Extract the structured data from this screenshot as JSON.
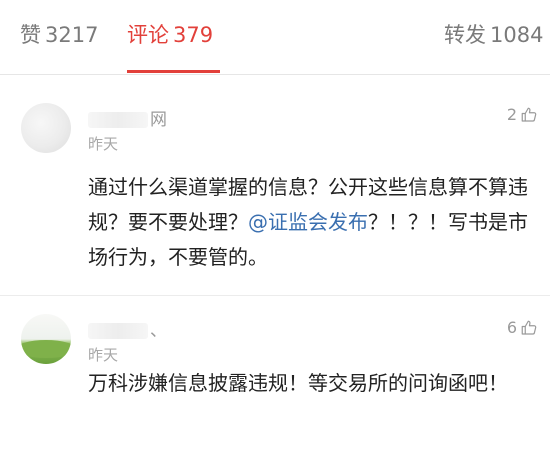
{
  "tabs": {
    "likes": {
      "label": "赞",
      "count": "3217"
    },
    "comments": {
      "label": "评论",
      "count": "379"
    },
    "reposts": {
      "label": "转发",
      "count": "1084"
    },
    "active": "comments",
    "active_color": "#e2403a"
  },
  "comments": [
    {
      "username": "网",
      "time": "昨天",
      "likes": "2",
      "text_before": "通过什么渠道掌握的信息？公开这些信息算不算违规？要不要处理？",
      "mention": "@证监会发布",
      "text_after": "？！？！写书是市场行为，不要管的。",
      "mention_color": "#3a6fb0"
    },
    {
      "username": "、",
      "time": "昨天",
      "likes": "6",
      "text": "万科涉嫌信息披露违规！等交易所的问询函吧！"
    }
  ],
  "icons": {
    "like": "thumbs-up-icon"
  }
}
